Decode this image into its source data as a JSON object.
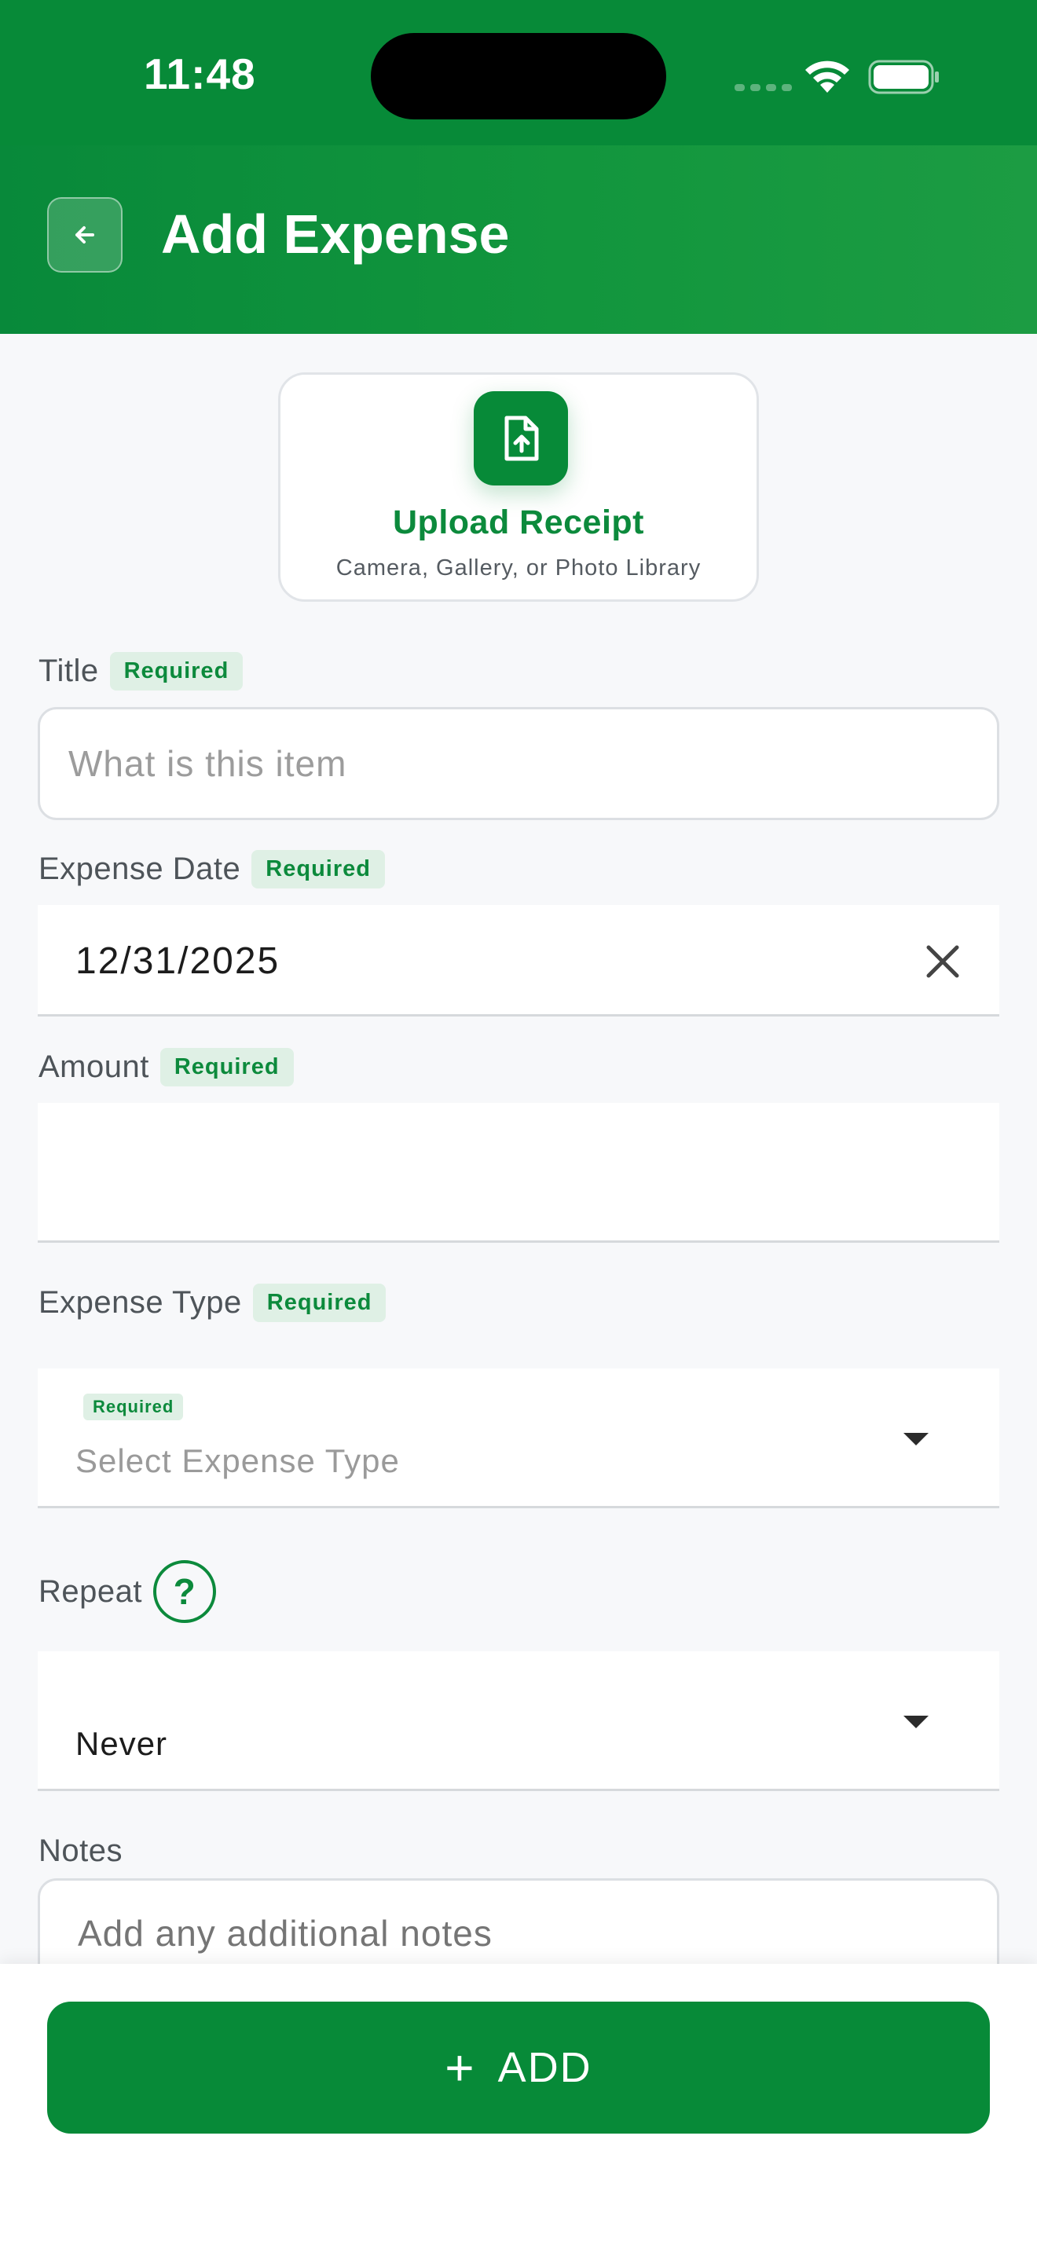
{
  "status_bar": {
    "time": "11:48"
  },
  "header": {
    "title": "Add Expense"
  },
  "upload": {
    "title": "Upload Receipt",
    "subtitle": "Camera, Gallery, or Photo Library"
  },
  "form": {
    "title": {
      "label": "Title",
      "badge": "Required",
      "placeholder": "What is this item"
    },
    "expense_date": {
      "label": "Expense Date",
      "badge": "Required",
      "value": "12/31/2025"
    },
    "amount": {
      "label": "Amount",
      "badge": "Required",
      "value": ""
    },
    "expense_type": {
      "label": "Expense Type",
      "badge": "Required",
      "inner_badge": "Required",
      "placeholder": "Select Expense Type"
    },
    "repeat": {
      "label": "Repeat",
      "help": "?",
      "value": "Never"
    },
    "notes": {
      "label": "Notes",
      "placeholder": "Add any additional notes"
    }
  },
  "actions": {
    "add_label": "ADD",
    "add_icon": "plus-icon"
  },
  "colors": {
    "brand": "#078a38",
    "badge_bg": "#dff0e5",
    "badge_text": "#0c8a3c"
  }
}
